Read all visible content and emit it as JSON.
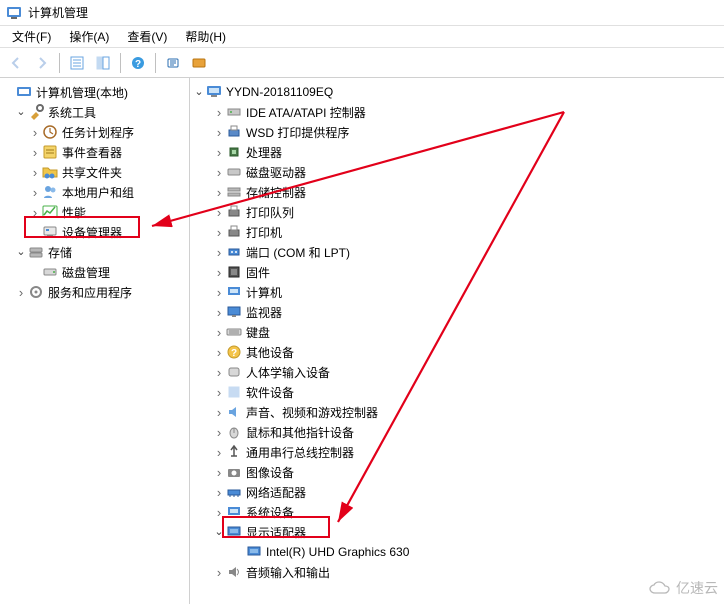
{
  "title": "计算机管理",
  "menubar": {
    "file": "文件(F)",
    "action": "操作(A)",
    "view": "查看(V)",
    "help": "帮助(H)"
  },
  "left_tree": {
    "root": "计算机管理(本地)",
    "system_tools": "系统工具",
    "task_scheduler": "任务计划程序",
    "event_viewer": "事件查看器",
    "shared_folders": "共享文件夹",
    "local_users": "本地用户和组",
    "performance": "性能",
    "device_manager": "设备管理器",
    "storage": "存储",
    "disk_mgmt": "磁盘管理",
    "services_apps": "服务和应用程序"
  },
  "right_tree": {
    "computer_name": "YYDN-20181109EQ",
    "ide_atapi": "IDE ATA/ATAPI 控制器",
    "wsd": "WSD 打印提供程序",
    "cpu": "处理器",
    "disk_drives": "磁盘驱动器",
    "storage_ctrl": "存储控制器",
    "print_queues": "打印队列",
    "printers": "打印机",
    "ports": "端口 (COM 和 LPT)",
    "firmware": "固件",
    "computer": "计算机",
    "monitors": "监视器",
    "keyboards": "键盘",
    "other_devices": "其他设备",
    "hid": "人体学输入设备",
    "software_devices": "软件设备",
    "sound": "声音、视频和游戏控制器",
    "mice": "鼠标和其他指针设备",
    "usb": "通用串行总线控制器",
    "imaging": "图像设备",
    "network": "网络适配器",
    "system_devices": "系统设备",
    "display_adapters": "显示适配器",
    "gpu_item": "Intel(R) UHD Graphics 630",
    "audio_io": "音频输入和输出"
  },
  "watermark": "亿速云"
}
